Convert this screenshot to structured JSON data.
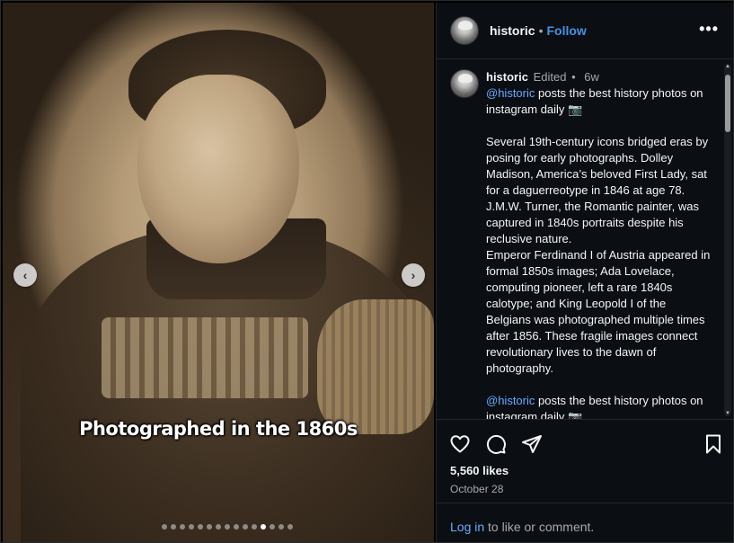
{
  "media": {
    "overlay_caption": "Photographed in the 1860s",
    "carousel": {
      "total": 15,
      "active_index": 11
    }
  },
  "header": {
    "username": "historic",
    "separator": "•",
    "follow_label": "Follow",
    "more_label": "•••"
  },
  "caption": {
    "username": "historic",
    "edited_label": "Edited",
    "separator": "•",
    "age": "6w",
    "mention": "@historic",
    "intro": " posts the best history photos on instagram daily 📷",
    "paragraph_1": "Several 19th-century icons bridged eras by posing for early photographs. Dolley Madison, America’s beloved First Lady, sat for a daguerreotype in 1846 at age 78. J.M.W. Turner, the Romantic painter, was captured in 1840s portraits despite his reclusive nature.",
    "paragraph_2": "Emperor Ferdinand I of Austria appeared in formal 1850s images; Ada Lovelace, computing pioneer, left a rare 1840s calotype; and King Leopold I of the Belgians was photographed multiple times after 1856. These fragile images connect revolutionary lives to the dawn of photography.",
    "outro_mention": "@historic",
    "outro": " posts the best history photos on instagram daily 📷"
  },
  "stats": {
    "likes": "5,560 likes",
    "date": "October 28"
  },
  "footer": {
    "login_label": "Log in",
    "suffix": " to like or comment."
  },
  "icons": {
    "prev": "chevron-left-icon",
    "next": "chevron-right-icon",
    "like": "heart-icon",
    "comment": "comment-icon",
    "share": "share-icon",
    "save": "bookmark-icon"
  },
  "colors": {
    "background": "#0b0f14",
    "link": "#6ea8ff",
    "follow": "#4a90e2",
    "muted": "#a8a8a8"
  }
}
